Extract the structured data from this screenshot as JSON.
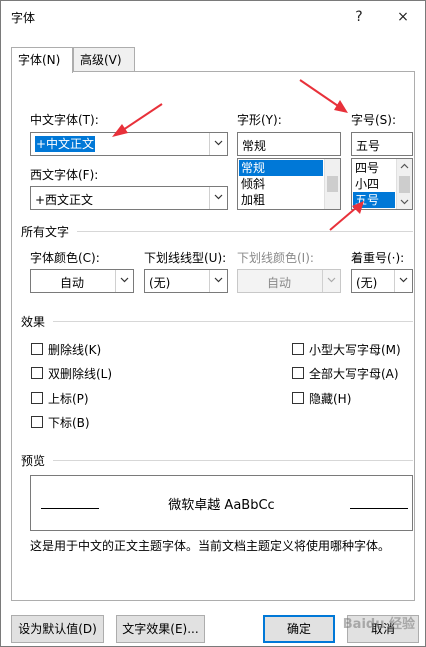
{
  "window": {
    "title": "字体",
    "help_label": "?",
    "close_label": "×"
  },
  "tabs": [
    {
      "label": "字体(N)",
      "active": true
    },
    {
      "label": "高级(V)",
      "active": false
    }
  ],
  "fields": {
    "cn_font_label": "中文字体(T):",
    "cn_font_value": "+中文正文",
    "west_font_label": "西文字体(F):",
    "west_font_value": "+西文正文",
    "style_label": "字形(Y):",
    "style_value": "常规",
    "style_list": [
      "常规",
      "倾斜",
      "加粗"
    ],
    "size_label": "字号(S):",
    "size_value": "五号",
    "size_list": [
      "四号",
      "小四",
      "五号"
    ]
  },
  "all_text": {
    "title": "所有文字",
    "color_label": "字体颜色(C):",
    "color_value": "自动",
    "underline_label": "下划线线型(U):",
    "underline_value": "(无)",
    "underline_color_label": "下划线颜色(I):",
    "underline_color_value": "自动",
    "emphasis_label": "着重号(·):",
    "emphasis_value": "(无)"
  },
  "effects": {
    "title": "效果",
    "left": [
      "删除线(K)",
      "双删除线(L)",
      "上标(P)",
      "下标(B)"
    ],
    "right": [
      "小型大写字母(M)",
      "全部大写字母(A)",
      "隐藏(H)"
    ]
  },
  "preview": {
    "title": "预览",
    "sample": "微软卓越  AaBbCc",
    "description": "这是用于中文的正文主题字体。当前文档主题定义将使用哪种字体。"
  },
  "buttons": {
    "set_default": "设为默认值(D)",
    "text_effects": "文字效果(E)...",
    "ok": "确定",
    "cancel": "取消"
  },
  "watermark": "Baidu 经验",
  "colors": {
    "accent": "#0078d7",
    "annotation_arrow": "#e8313a"
  }
}
